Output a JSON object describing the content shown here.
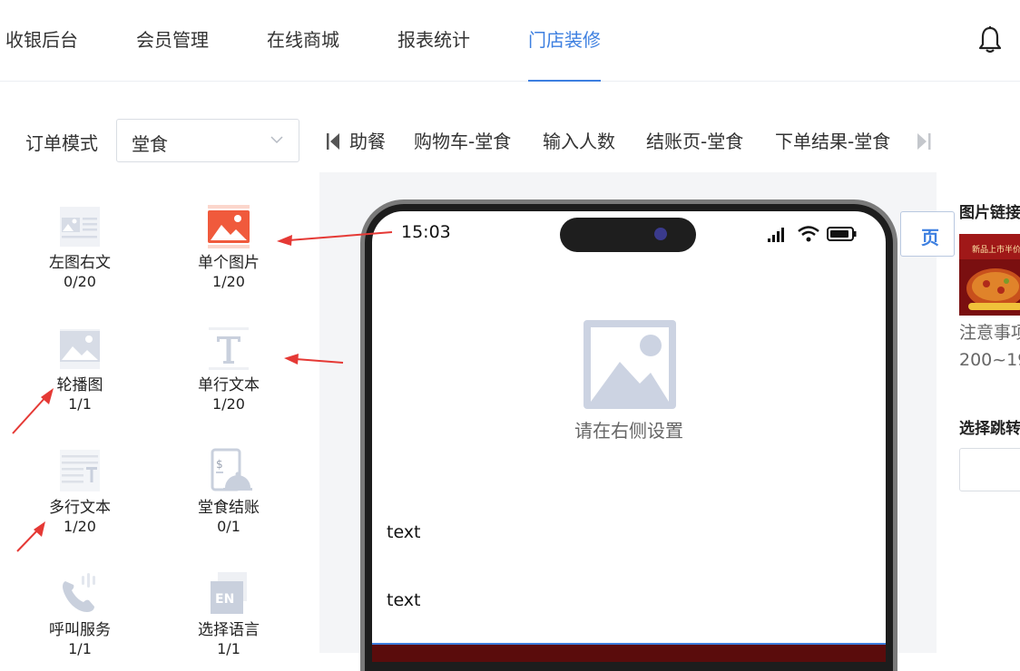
{
  "nav": {
    "items": [
      "收银后台",
      "会员管理",
      "在线商城",
      "报表统计",
      "门店装修"
    ],
    "active_index": 4
  },
  "mode": {
    "label": "订单模式",
    "selected": "堂食"
  },
  "page_tabs": [
    "助餐",
    "购物车-堂食",
    "输入人数",
    "结账页-堂食",
    "下单结果-堂食"
  ],
  "components": [
    {
      "name": "左图右文",
      "count": "0/20",
      "icon": "left-image-right-text-icon"
    },
    {
      "name": "单个图片",
      "count": "1/20",
      "icon": "single-image-icon"
    },
    {
      "name": "轮播图",
      "count": "1/1",
      "icon": "carousel-icon"
    },
    {
      "name": "单行文本",
      "count": "1/20",
      "icon": "single-line-text-icon"
    },
    {
      "name": "多行文本",
      "count": "1/20",
      "icon": "multi-line-text-icon"
    },
    {
      "name": "堂食结账",
      "count": "0/1",
      "icon": "dine-in-checkout-icon"
    },
    {
      "name": "呼叫服务",
      "count": "1/1",
      "icon": "call-service-icon"
    },
    {
      "name": "选择语言",
      "count": "1/1",
      "icon": "select-language-icon"
    }
  ],
  "phone": {
    "time": "15:03",
    "placeholder": "请在右侧设置",
    "text_items": [
      "text",
      "text"
    ]
  },
  "side_button": {
    "label": "页"
  },
  "right_panel": {
    "image_link_title": "图片链接",
    "note": "注意事项",
    "size_hint": "200~19",
    "jump_title": "选择跳转"
  },
  "colors": {
    "accent": "#3d7fe0",
    "arrow": "#e53935",
    "icon_gray": "#c9d0dd",
    "image_orange": "#f05a3c"
  }
}
